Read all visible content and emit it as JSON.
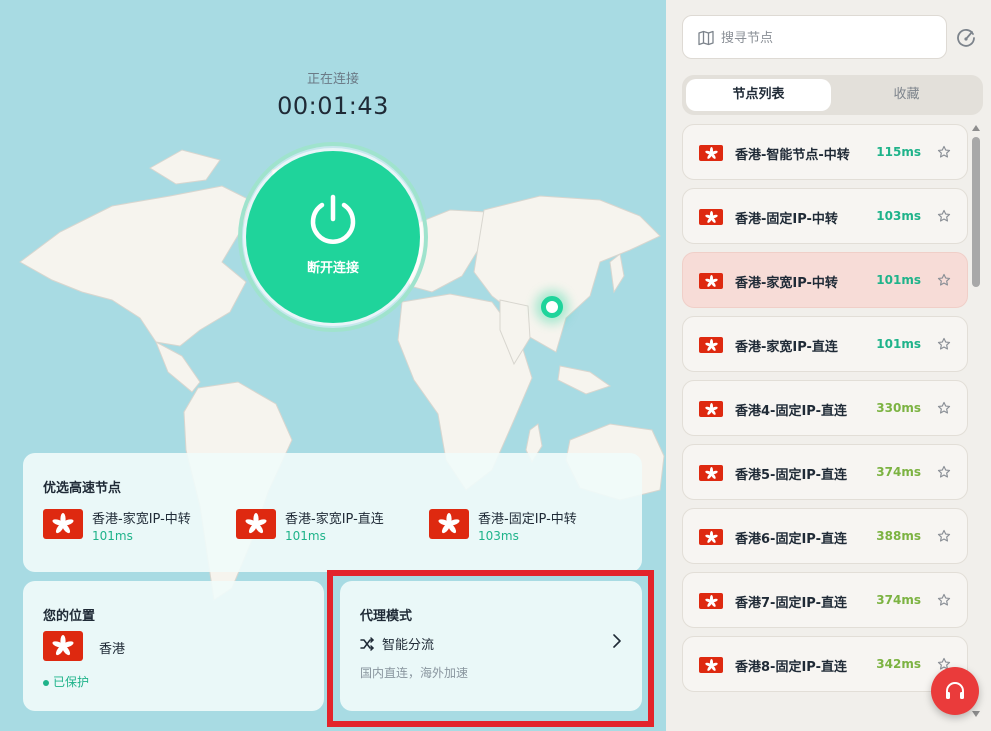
{
  "connection": {
    "status_label": "正在连接",
    "timer": "00:01:43",
    "power_label": "断开连接"
  },
  "colors": {
    "accent_green": "#1fd49b",
    "flag_red": "#de2910",
    "highlight_red": "#e3242b",
    "ping_fast": "#1fb38a",
    "ping_slow": "#7cb342"
  },
  "fast_nodes": {
    "title": "优选高速节点",
    "items": [
      {
        "name": "香港-家宽IP-中转",
        "ping": "101ms"
      },
      {
        "name": "香港-家宽IP-直连",
        "ping": "101ms"
      },
      {
        "name": "香港-固定IP-中转",
        "ping": "103ms"
      }
    ]
  },
  "location": {
    "title": "您的位置",
    "region": "香港",
    "status": "已保护"
  },
  "proxy_mode": {
    "title": "代理模式",
    "mode": "智能分流",
    "description": "国内直连，海外加速"
  },
  "sidebar": {
    "search_placeholder": "搜寻节点",
    "tabs": [
      {
        "label": "节点列表",
        "active": true
      },
      {
        "label": "收藏",
        "active": false
      }
    ],
    "nodes": [
      {
        "name": "香港-智能节点-中转",
        "ping": "115ms",
        "active": false
      },
      {
        "name": "香港-固定IP-中转",
        "ping": "103ms",
        "active": false
      },
      {
        "name": "香港-家宽IP-中转",
        "ping": "101ms",
        "active": true
      },
      {
        "name": "香港-家宽IP-直连",
        "ping": "101ms",
        "active": false
      },
      {
        "name": "香港4-固定IP-直连",
        "ping": "330ms",
        "active": false
      },
      {
        "name": "香港5-固定IP-直连",
        "ping": "374ms",
        "active": false
      },
      {
        "name": "香港6-固定IP-直连",
        "ping": "388ms",
        "active": false
      },
      {
        "name": "香港7-固定IP-直连",
        "ping": "374ms",
        "active": false
      },
      {
        "name": "香港8-固定IP-直连",
        "ping": "342ms",
        "active": false
      }
    ]
  },
  "icons": {
    "search": "map-icon",
    "speed_test": "speedometer-icon",
    "power": "power-icon",
    "mode": "shuffle-icon",
    "chevron": "chevron-right-icon",
    "favorite": "star-icon",
    "support": "headset-icon",
    "flag": "hong-kong-flag-icon"
  }
}
